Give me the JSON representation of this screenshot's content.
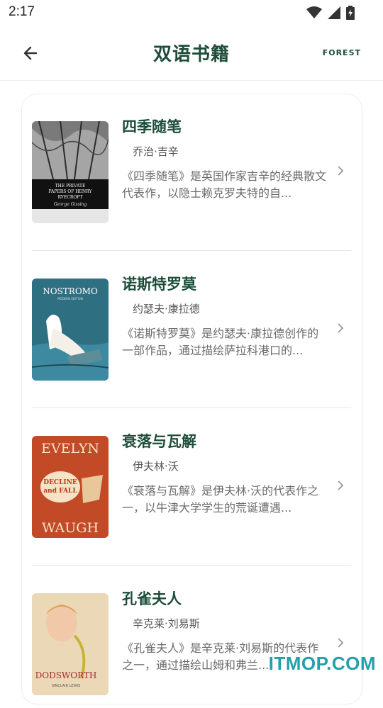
{
  "status_bar": {
    "time": "2:17"
  },
  "app_bar": {
    "title": "双语书籍",
    "badge": "FOREST"
  },
  "books": [
    {
      "title": "四季随笔",
      "author": "乔治·吉辛",
      "description": "《四季随笔》是英国作家吉辛的经典散文代表作，以隐士赖克罗夫特的自..."
    },
    {
      "title": "诺斯特罗莫",
      "author": "约瑟夫·康拉德",
      "description": "《诺斯特罗莫》是约瑟夫·康拉德创作的一部作品，通过描绘萨拉科港口的..."
    },
    {
      "title": "衰落与瓦解",
      "author": "伊夫林·沃",
      "description": "《衰落与瓦解》是伊夫林·沃的代表作之一，以牛津大学学生的荒诞遭遇..."
    },
    {
      "title": "孔雀夫人",
      "author": "辛克莱·刘易斯",
      "description": "《孔雀夫人》是辛克莱·刘易斯的代表作之一，通过描绘山姆和弗兰..."
    }
  ],
  "covers": [
    {
      "text1": "THE PRIVATE PAPERS OF HENRY RYECROFT",
      "text2": "George Gissing"
    },
    {
      "text1": "NOSTROMO",
      "text2": "MODERN EDITION"
    },
    {
      "text1": "EVELYN",
      "text2": "DECLINE and FALL",
      "text3": "WAUGH"
    },
    {
      "text1": "DODSWORTH",
      "text2": "SINCLAIR LEWIS"
    }
  ],
  "watermark": "ITMOP.COM",
  "colors": {
    "accent": "#1e4d3a",
    "watermark": "#22a0ad"
  }
}
